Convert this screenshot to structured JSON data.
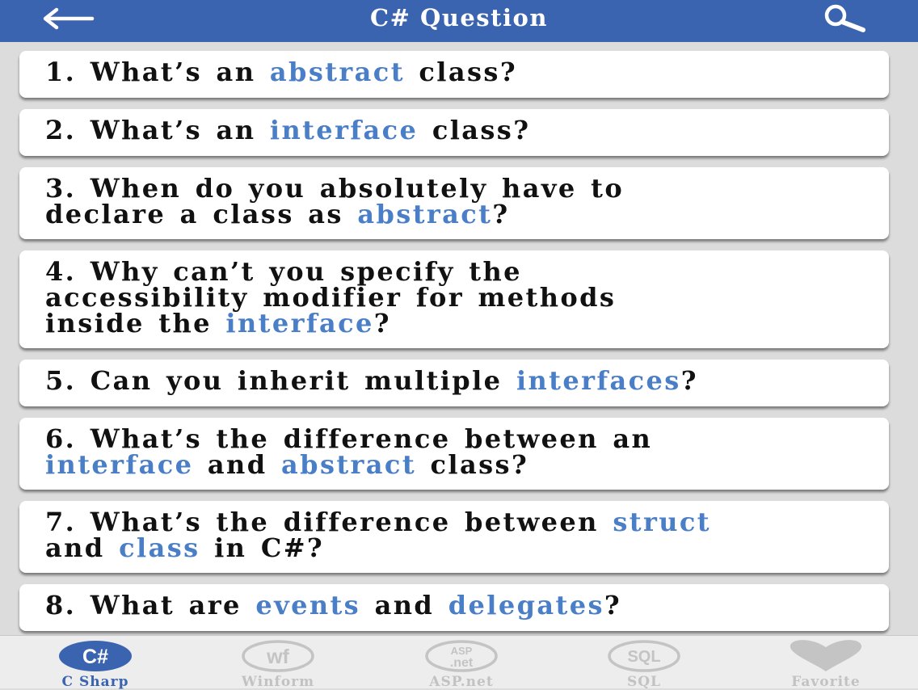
{
  "header": {
    "title": "C# Question",
    "back_icon": "back-arrow-icon",
    "search_icon": "search-icon"
  },
  "colors": {
    "header_bg": "#3a63b0",
    "highlight": "#4a7fc7",
    "active_tab": "#3a63b0",
    "inactive_tab": "#c2c2c2"
  },
  "questions": [
    {
      "lines": [
        [
          {
            "t": "1. What’s an "
          },
          {
            "t": "abstract",
            "hl": true
          },
          {
            "t": " class?"
          }
        ]
      ]
    },
    {
      "lines": [
        [
          {
            "t": "2. What’s an "
          },
          {
            "t": "interface",
            "hl": true
          },
          {
            "t": " class?"
          }
        ]
      ]
    },
    {
      "lines": [
        [
          {
            "t": "3. When do you absolutely have to"
          }
        ],
        [
          {
            "t": "declare a class as "
          },
          {
            "t": "abstract",
            "hl": true
          },
          {
            "t": "?"
          }
        ]
      ]
    },
    {
      "lines": [
        [
          {
            "t": "4. Why can’t you specify the"
          }
        ],
        [
          {
            "t": "accessibility modifier for methods"
          }
        ],
        [
          {
            "t": "inside the "
          },
          {
            "t": "interface",
            "hl": true
          },
          {
            "t": "?"
          }
        ]
      ]
    },
    {
      "lines": [
        [
          {
            "t": "5. Can you inherit multiple "
          },
          {
            "t": "interfaces",
            "hl": true
          },
          {
            "t": "?"
          }
        ]
      ]
    },
    {
      "lines": [
        [
          {
            "t": "6. What’s the difference between an"
          }
        ],
        [
          {
            "t": "interface",
            "hl": true
          },
          {
            "t": " and "
          },
          {
            "t": "abstract",
            "hl": true
          },
          {
            "t": " class?"
          }
        ]
      ]
    },
    {
      "lines": [
        [
          {
            "t": "7. What’s the difference between "
          },
          {
            "t": "struct",
            "hl": true
          }
        ],
        [
          {
            "t": "and "
          },
          {
            "t": "class",
            "hl": true
          },
          {
            "t": " in C#?"
          }
        ]
      ]
    },
    {
      "lines": [
        [
          {
            "t": "8. What are "
          },
          {
            "t": "events",
            "hl": true
          },
          {
            "t": " and "
          },
          {
            "t": "delegates",
            "hl": true
          },
          {
            "t": "?"
          }
        ]
      ]
    }
  ],
  "tabs": [
    {
      "label": "C Sharp",
      "icon": "csharp-icon",
      "icon_text": "C#",
      "active": true
    },
    {
      "label": "Winform",
      "icon": "winform-icon",
      "icon_text": "wf",
      "active": false
    },
    {
      "label": "ASP.net",
      "icon": "aspnet-icon",
      "icon_text_top": "ASP",
      "icon_text_bottom": ".net",
      "active": false
    },
    {
      "label": "SQL",
      "icon": "sql-icon",
      "icon_text": "SQL",
      "active": false
    },
    {
      "label": "Favorite",
      "icon": "heart-icon",
      "active": false
    }
  ]
}
